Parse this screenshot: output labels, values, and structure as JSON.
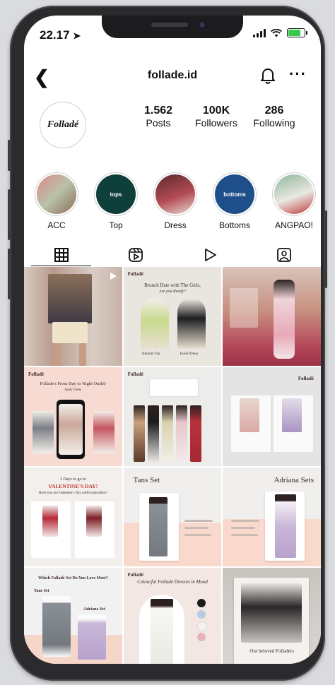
{
  "status": {
    "time": "22.17"
  },
  "header": {
    "username": "follade.id"
  },
  "profile": {
    "avatar_text": "Folladé",
    "stats": [
      {
        "value": "1.562",
        "label": "Posts"
      },
      {
        "value": "100K",
        "label": "Followers"
      },
      {
        "value": "286",
        "label": "Following"
      }
    ]
  },
  "highlights": [
    {
      "label": "ACC",
      "color": "#d98a8a",
      "text": ""
    },
    {
      "label": "Top",
      "color": "#0f3f3a",
      "text": "tops"
    },
    {
      "label": "Dress",
      "color": "#b34a55",
      "text": ""
    },
    {
      "label": "Bottoms",
      "color": "#1f4f8a",
      "text": "bottoms"
    },
    {
      "label": "ANGPAO!",
      "color": "#8fb59a",
      "text": ""
    }
  ],
  "tabs": [
    "grid",
    "reels",
    "video",
    "tagged"
  ],
  "posts": {
    "brand": "Folladé",
    "brunch": {
      "title": "Brunch Date with The Girls,",
      "subtitle": "Are you Ready?",
      "item1": "Summer Top",
      "item2": "Eyelid Dress"
    },
    "night": {
      "title": "Follade's From Day to Night Outfit!",
      "subtitle": "Sanly Dress"
    },
    "valentine": {
      "line1": "2 Days to go to",
      "line2": "VALENTINE'S DAY!",
      "line3": "Have you our Valentine's Day outfit inspiration?"
    },
    "tans": {
      "title": "Tans Set"
    },
    "adriana": {
      "title": "Adriana Sets"
    },
    "which": {
      "title": "Which Folladé Set Do You Love Most?",
      "a": "Tans Set",
      "b": "Adriana Set"
    },
    "colorful": {
      "title": "Colourful Folladé Dresses in Mood"
    },
    "beloved": {
      "title": "Our beloved Folladers"
    }
  }
}
